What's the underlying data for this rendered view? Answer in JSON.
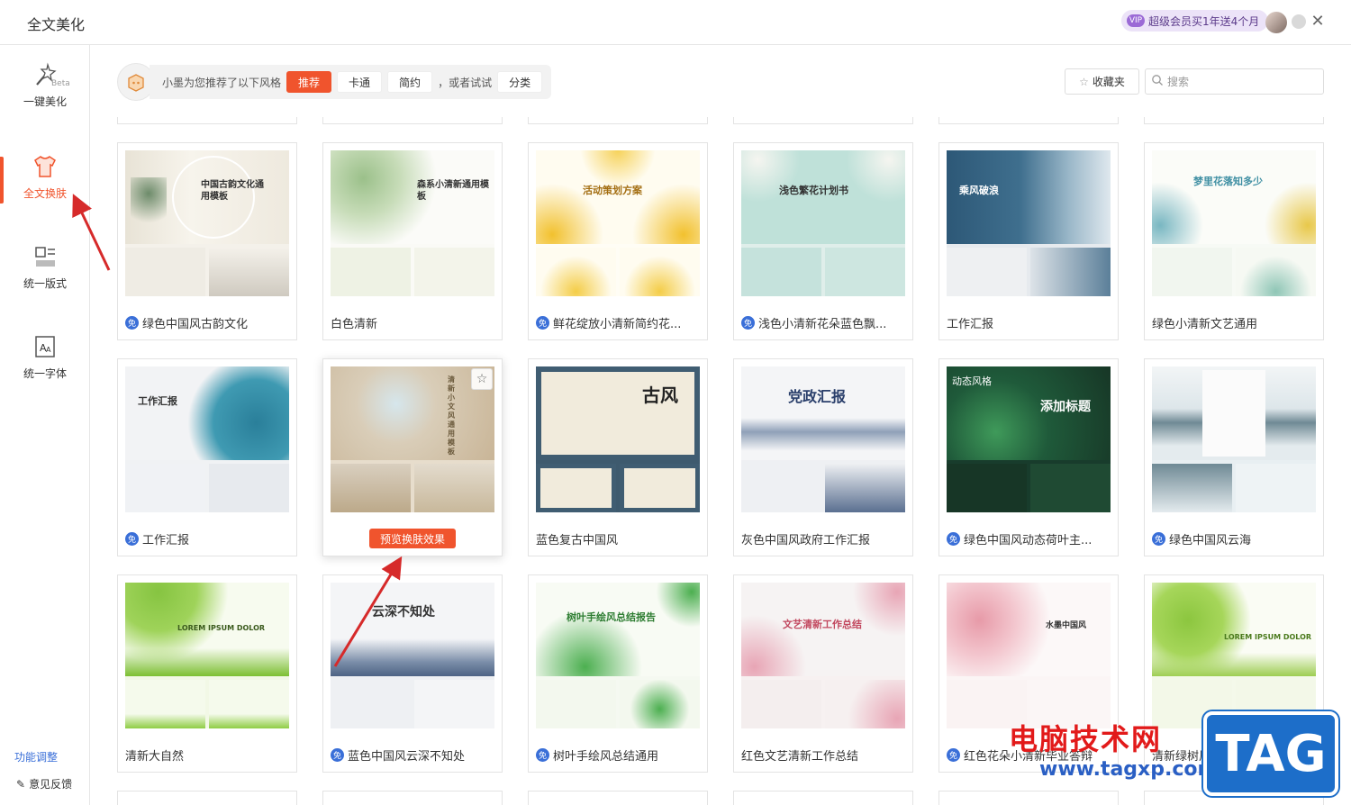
{
  "window": {
    "title": "全文美化"
  },
  "promo": {
    "badge": "VIP",
    "text": "超级会员买1年送4个月"
  },
  "sidebar": {
    "items": [
      {
        "label": "一键美化",
        "beta": "Beta"
      },
      {
        "label": "全文换肤"
      },
      {
        "label": "统一版式"
      },
      {
        "label": "统一字体"
      }
    ],
    "feature_adjust": "功能调整",
    "feedback": "意见反馈"
  },
  "toolbar": {
    "recommend_text": "小墨为您推荐了以下风格",
    "chips": [
      "推荐",
      "卡通",
      "简约"
    ],
    "or_try": "，或者试试",
    "category": "分类",
    "favorites": "收藏夹",
    "search_placeholder": "搜索"
  },
  "templates": [
    {
      "name": "绿色中国风古韵文化",
      "free": true,
      "thumb_title": "中国古韵文化通用模板"
    },
    {
      "name": "白色清新",
      "free": false,
      "thumb_title": "森系小清新通用模板"
    },
    {
      "name": "鲜花绽放小清新简约花...",
      "free": true,
      "thumb_title": "活动策划方案"
    },
    {
      "name": "浅色小清新花朵蓝色飘...",
      "free": true,
      "thumb_title": "浅色繁花计划书"
    },
    {
      "name": "工作汇报",
      "free": false,
      "thumb_title": "乘风破浪"
    },
    {
      "name": "绿色小清新文艺通用",
      "free": false,
      "thumb_title": "梦里花落知多少"
    },
    {
      "name": "工作汇报",
      "free": true,
      "thumb_title": "工作汇报"
    },
    {
      "name": "",
      "free": false,
      "thumb_title": "清新小文风通用模板",
      "preview_label": "预览换肤效果"
    },
    {
      "name": "蓝色复古中国风",
      "free": false,
      "thumb_title": "古风"
    },
    {
      "name": "灰色中国风政府工作汇报",
      "free": false,
      "thumb_title": "党政汇报"
    },
    {
      "name": "绿色中国风动态荷叶主...",
      "free": true,
      "thumb_title": "添加标题",
      "thumb_tag": "动态风格"
    },
    {
      "name": "绿色中国风云海",
      "free": true,
      "thumb_title": ""
    },
    {
      "name": "清新大自然",
      "free": false,
      "thumb_title": "LOREM IPSUM DOLOR"
    },
    {
      "name": "蓝色中国风云深不知处",
      "free": true,
      "thumb_title": "云深不知处"
    },
    {
      "name": "树叶手绘风总结通用",
      "free": true,
      "thumb_title": "树叶手绘风总结报告"
    },
    {
      "name": "红色文艺清新工作总结",
      "free": false,
      "thumb_title": "文艺清新工作总结"
    },
    {
      "name": "红色花朵小清新毕业答辩",
      "free": true,
      "thumb_title": "水墨中国风"
    },
    {
      "name": "清新绿树风",
      "free": false,
      "thumb_title": "LOREM IPSUM DOLOR"
    }
  ],
  "watermark": {
    "line1": "电脑技术网",
    "line2": "www.tagxp.com",
    "tag": "TAG"
  },
  "colors": {
    "accent": "#f0542d",
    "link": "#3a6fd8",
    "free_badge": "#3a6fd8"
  }
}
